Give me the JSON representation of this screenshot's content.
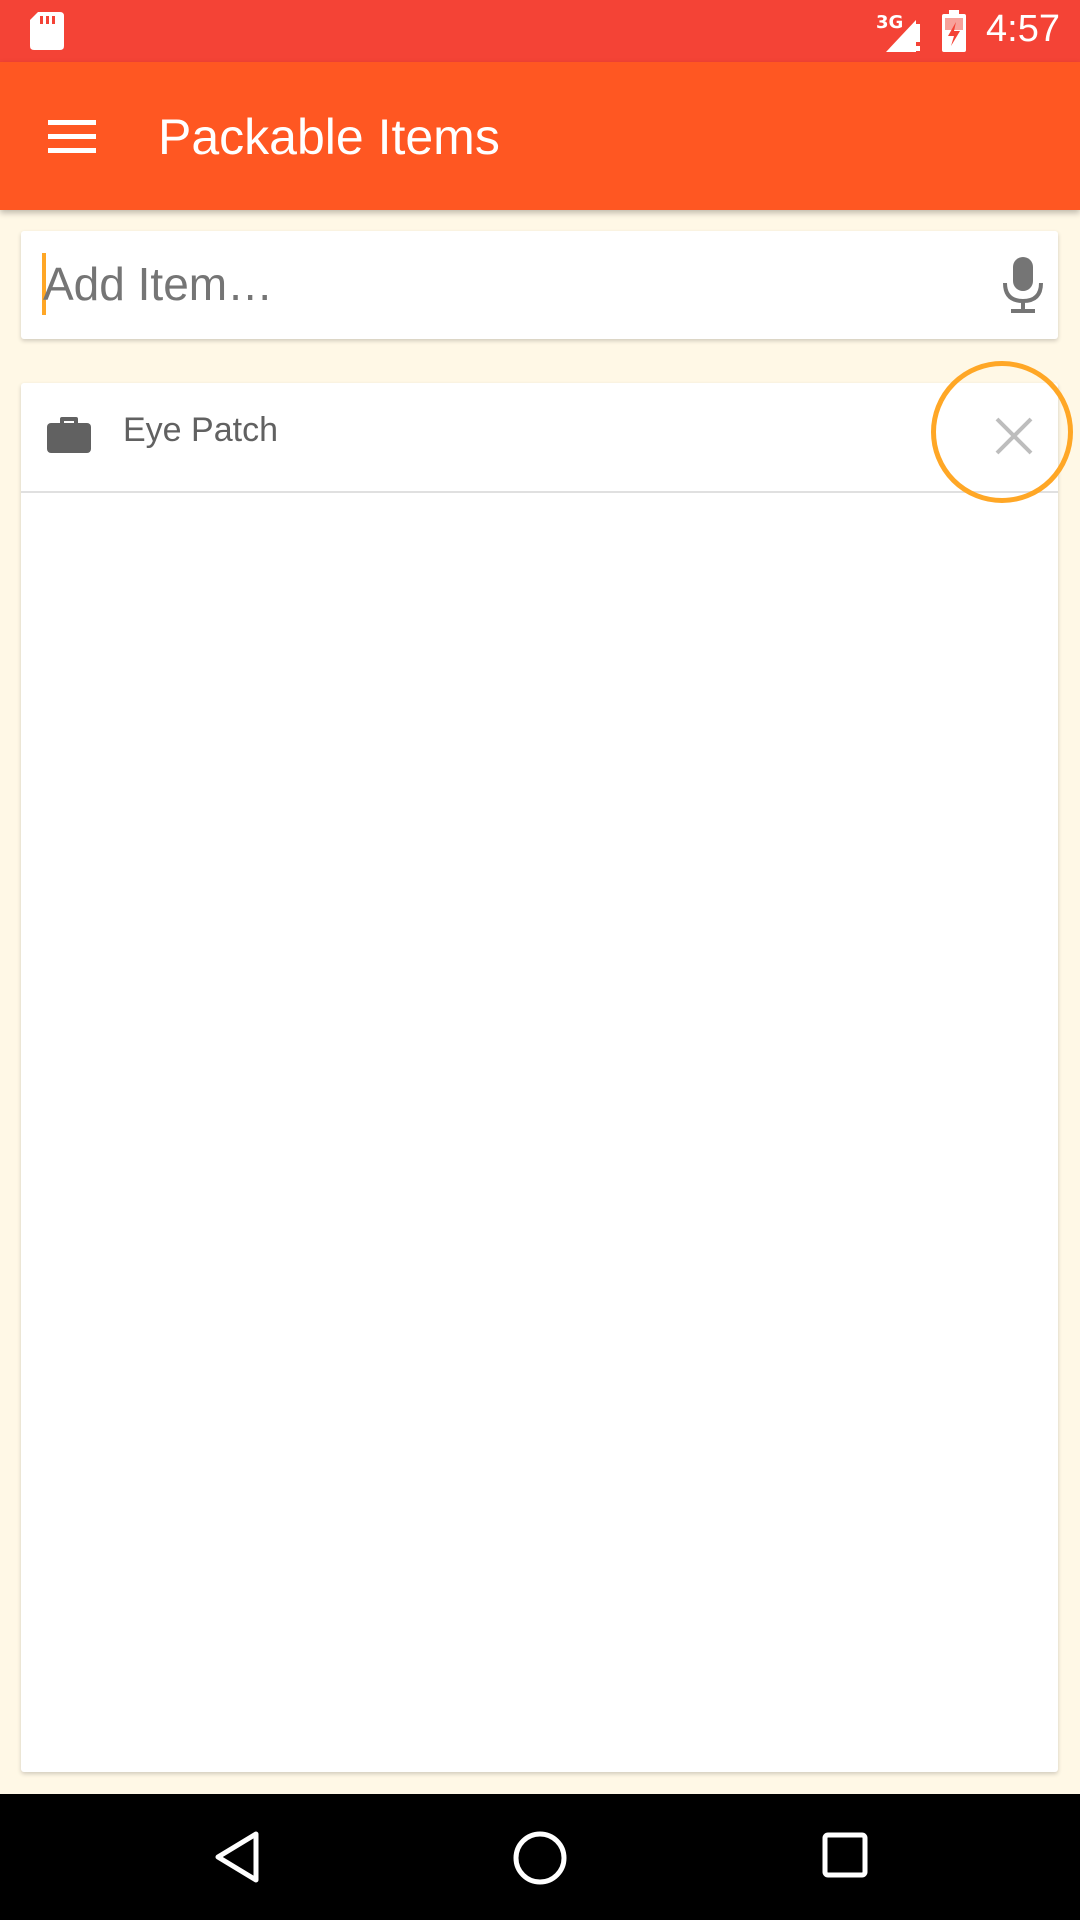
{
  "status_bar": {
    "network_type": "3G",
    "time": "4:57"
  },
  "app_bar": {
    "title": "Packable Items"
  },
  "add_item": {
    "placeholder": "Add Item…"
  },
  "items": [
    {
      "label": "Eye Patch",
      "icon": "briefcase-icon"
    }
  ],
  "colors": {
    "status_bar": "#F44336",
    "app_bar": "#FF5722",
    "accent": "#FFA726",
    "background": "#FFF8E6"
  }
}
